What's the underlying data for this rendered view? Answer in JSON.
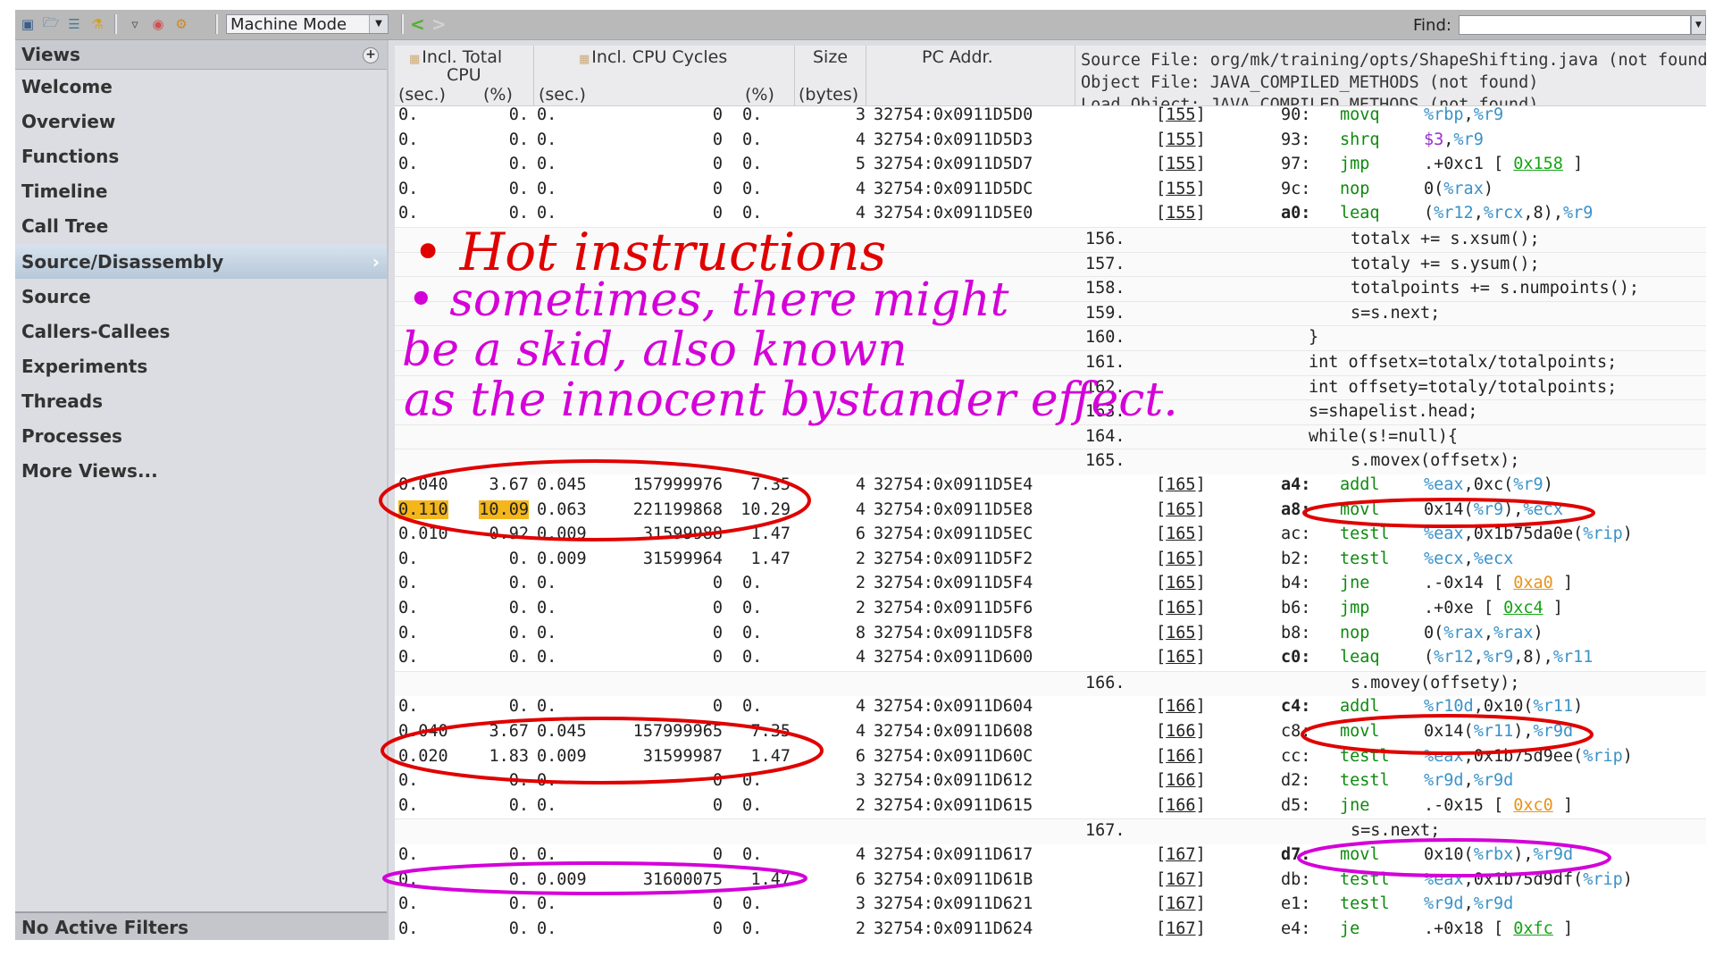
{
  "toolbar": {
    "icons": [
      "save-experiment-icon",
      "open-experiment-icon",
      "compare-icon",
      "new-experiment-icon",
      "filter-icon",
      "profile-icon",
      "settings-icon"
    ],
    "mode_select": "Machine Mode",
    "find_label": "Find:",
    "find_value": ""
  },
  "sidebar": {
    "title": "Views",
    "items": [
      {
        "label": "Welcome"
      },
      {
        "label": "Overview"
      },
      {
        "label": "Functions"
      },
      {
        "label": "Timeline"
      },
      {
        "label": "Call Tree"
      },
      {
        "label": "Source/Disassembly",
        "selected": true
      },
      {
        "label": "Source"
      },
      {
        "label": "Callers-Callees"
      },
      {
        "label": "Experiments"
      },
      {
        "label": "Threads"
      },
      {
        "label": "Processes"
      },
      {
        "label": "More Views..."
      }
    ],
    "filters_label": "No Active Filters"
  },
  "table": {
    "headers": {
      "incl_total_cpu": "Incl. Total CPU",
      "incl_total_cpu_line1": "Incl. Total",
      "incl_total_cpu_line2": "CPU",
      "incl_total_sec": "(sec.)",
      "incl_total_pct": "(%)",
      "incl_cycles": "Incl. CPU Cycles",
      "incl_cycles_sec": "(sec.)",
      "incl_cycles_pct": "(%)",
      "size": "Size",
      "size_unit": "(bytes)",
      "pc_addr": "PC Addr."
    },
    "info": {
      "source_file": "Source File: org/mk/training/opts/ShapeShifting.java (not found)",
      "object_file": "Object File: JAVA_COMPILED_METHODS (not found)",
      "load_object": "Load Object: JAVA_COMPILED_METHODS (not found)"
    },
    "rows": [
      {
        "type": "instr",
        "tsec": "0.",
        "tpct": "0.",
        "csec": "0.",
        "cyc": "0",
        "cpct": "0.",
        "size": "3",
        "pc": "32754:0x0911D5D0",
        "line": "155",
        "off": "90:",
        "mn": "movq",
        "ops": [
          [
            "reg",
            "%rbp"
          ],
          [
            "txt",
            ","
          ],
          [
            "reg",
            "%r9"
          ]
        ]
      },
      {
        "type": "instr",
        "tsec": "0.",
        "tpct": "0.",
        "csec": "0.",
        "cyc": "0",
        "cpct": "0.",
        "size": "4",
        "pc": "32754:0x0911D5D3",
        "line": "155",
        "off": "93:",
        "mn": "shrq",
        "ops": [
          [
            "imm",
            "$3"
          ],
          [
            "txt",
            ","
          ],
          [
            "reg",
            "%r9"
          ]
        ]
      },
      {
        "type": "instr",
        "tsec": "0.",
        "tpct": "0.",
        "csec": "0.",
        "cyc": "0",
        "cpct": "0.",
        "size": "5",
        "pc": "32754:0x0911D5D7",
        "line": "155",
        "off": "97:",
        "mn": "jmp",
        "ops": [
          [
            "txt",
            ".+0xc1 [ "
          ],
          [
            "lg",
            "0x158"
          ],
          [
            "txt",
            " ]"
          ]
        ]
      },
      {
        "type": "instr",
        "tsec": "0.",
        "tpct": "0.",
        "csec": "0.",
        "cyc": "0",
        "cpct": "0.",
        "size": "4",
        "pc": "32754:0x0911D5DC",
        "line": "155",
        "off": "9c:",
        "mn": "nop",
        "ops": [
          [
            "txt",
            "0("
          ],
          [
            "reg",
            "%rax"
          ],
          [
            "txt",
            ")"
          ]
        ]
      },
      {
        "type": "instr",
        "tsec": "0.",
        "tpct": "0.",
        "csec": "0.",
        "cyc": "0",
        "cpct": "0.",
        "size": "4",
        "pc": "32754:0x0911D5E0",
        "line": "155",
        "off": "a0:",
        "bold": true,
        "mn": "leaq",
        "ops": [
          [
            "txt",
            "("
          ],
          [
            "reg",
            "%r12"
          ],
          [
            "txt",
            ","
          ],
          [
            "reg",
            "%rcx"
          ],
          [
            "txt",
            ",8),"
          ],
          [
            "reg",
            "%r9"
          ]
        ]
      },
      {
        "type": "src",
        "no": "156.",
        "indent": 3,
        "text": "totalx += s.xsum();"
      },
      {
        "type": "src",
        "no": "157.",
        "indent": 3,
        "text": "totaly += s.ysum();"
      },
      {
        "type": "src",
        "no": "158.",
        "indent": 3,
        "text": "totalpoints += s.numpoints();"
      },
      {
        "type": "src",
        "no": "159.",
        "indent": 3,
        "text": "s=s.next;"
      },
      {
        "type": "src",
        "no": "160.",
        "indent": 2,
        "text": "}"
      },
      {
        "type": "src",
        "no": "161.",
        "indent": 2,
        "text": "int offsetx=totalx/totalpoints;"
      },
      {
        "type": "src",
        "no": "162.",
        "indent": 2,
        "text": "int offsety=totaly/totalpoints;"
      },
      {
        "type": "src",
        "no": "163.",
        "indent": 2,
        "text": "s=shapelist.head;"
      },
      {
        "type": "src",
        "no": "164.",
        "indent": 2,
        "text": "while(s!=null){"
      },
      {
        "type": "src",
        "no": "165.",
        "indent": 3,
        "text": "s.movex(offsetx);"
      },
      {
        "type": "instr",
        "tsec": "0.040",
        "tpct": "3.67",
        "csec": "0.045",
        "cyc": "157999976",
        "cpct": "7.35",
        "size": "4",
        "pc": "32754:0x0911D5E4",
        "line": "165",
        "off": "a4:",
        "bold": true,
        "mn": "addl",
        "ops": [
          [
            "reg",
            "%eax"
          ],
          [
            "txt",
            ",0xc("
          ],
          [
            "reg",
            "%r9"
          ],
          [
            "txt",
            ")"
          ]
        ]
      },
      {
        "type": "instr",
        "hot": true,
        "tsec": "0.110",
        "tpct": "10.09",
        "csec": "0.063",
        "cyc": "221199868",
        "cpct": "10.29",
        "size": "4",
        "pc": "32754:0x0911D5E8",
        "line": "165",
        "off": "a8:",
        "bold": true,
        "mn": "movl",
        "ops": [
          [
            "txt",
            "0x14("
          ],
          [
            "reg",
            "%r9"
          ],
          [
            "txt",
            "),"
          ],
          [
            "reg",
            "%ecx"
          ]
        ]
      },
      {
        "type": "instr",
        "tsec": "0.010",
        "tpct": "0.92",
        "csec": "0.009",
        "cyc": "31599988",
        "cpct": "1.47",
        "size": "6",
        "pc": "32754:0x0911D5EC",
        "line": "165",
        "off": "ac:",
        "mn": "testl",
        "ops": [
          [
            "reg",
            "%eax"
          ],
          [
            "txt",
            ",0x1b75da0e("
          ],
          [
            "reg",
            "%rip"
          ],
          [
            "txt",
            ")"
          ]
        ]
      },
      {
        "type": "instr",
        "tsec": "0.",
        "tpct": "0.",
        "csec": "0.009",
        "cyc": "31599964",
        "cpct": "1.47",
        "size": "2",
        "pc": "32754:0x0911D5F2",
        "line": "165",
        "off": "b2:",
        "mn": "testl",
        "ops": [
          [
            "reg",
            "%ecx"
          ],
          [
            "txt",
            ","
          ],
          [
            "reg",
            "%ecx"
          ]
        ]
      },
      {
        "type": "instr",
        "tsec": "0.",
        "tpct": "0.",
        "csec": "0.",
        "cyc": "0",
        "cpct": "0.",
        "size": "2",
        "pc": "32754:0x0911D5F4",
        "line": "165",
        "off": "b4:",
        "mn": "jne",
        "ops": [
          [
            "txt",
            ".-0x14 [ "
          ],
          [
            "lo",
            "0xa0"
          ],
          [
            "txt",
            " ]"
          ]
        ]
      },
      {
        "type": "instr",
        "tsec": "0.",
        "tpct": "0.",
        "csec": "0.",
        "cyc": "0",
        "cpct": "0.",
        "size": "2",
        "pc": "32754:0x0911D5F6",
        "line": "165",
        "off": "b6:",
        "mn": "jmp",
        "ops": [
          [
            "txt",
            ".+0xe [ "
          ],
          [
            "lg",
            "0xc4"
          ],
          [
            "txt",
            " ]"
          ]
        ]
      },
      {
        "type": "instr",
        "tsec": "0.",
        "tpct": "0.",
        "csec": "0.",
        "cyc": "0",
        "cpct": "0.",
        "size": "8",
        "pc": "32754:0x0911D5F8",
        "line": "165",
        "off": "b8:",
        "mn": "nop",
        "ops": [
          [
            "txt",
            "0("
          ],
          [
            "reg",
            "%rax"
          ],
          [
            "txt",
            ","
          ],
          [
            "reg",
            "%rax"
          ],
          [
            "txt",
            ")"
          ]
        ]
      },
      {
        "type": "instr",
        "tsec": "0.",
        "tpct": "0.",
        "csec": "0.",
        "cyc": "0",
        "cpct": "0.",
        "size": "4",
        "pc": "32754:0x0911D600",
        "line": "165",
        "off": "c0:",
        "bold": true,
        "mn": "leaq",
        "ops": [
          [
            "txt",
            "("
          ],
          [
            "reg",
            "%r12"
          ],
          [
            "txt",
            ","
          ],
          [
            "reg",
            "%r9"
          ],
          [
            "txt",
            ",8),"
          ],
          [
            "reg",
            "%r11"
          ]
        ]
      },
      {
        "type": "src",
        "no": "166.",
        "indent": 3,
        "text": "s.movey(offsety);"
      },
      {
        "type": "instr",
        "tsec": "0.",
        "tpct": "0.",
        "csec": "0.",
        "cyc": "0",
        "cpct": "0.",
        "size": "4",
        "pc": "32754:0x0911D604",
        "line": "166",
        "off": "c4:",
        "bold": true,
        "mn": "addl",
        "ops": [
          [
            "reg",
            "%r10d"
          ],
          [
            "txt",
            ",0x10("
          ],
          [
            "reg",
            "%r11"
          ],
          [
            "txt",
            ")"
          ]
        ]
      },
      {
        "type": "instr",
        "tsec": "0.040",
        "tpct": "3.67",
        "csec": "0.045",
        "cyc": "157999965",
        "cpct": "7.35",
        "size": "4",
        "pc": "32754:0x0911D608",
        "line": "166",
        "off": "c8:",
        "mn": "movl",
        "ops": [
          [
            "txt",
            "0x14("
          ],
          [
            "reg",
            "%r11"
          ],
          [
            "txt",
            "),"
          ],
          [
            "reg",
            "%r9d"
          ]
        ]
      },
      {
        "type": "instr",
        "tsec": "0.020",
        "tpct": "1.83",
        "csec": "0.009",
        "cyc": "31599987",
        "cpct": "1.47",
        "size": "6",
        "pc": "32754:0x0911D60C",
        "line": "166",
        "off": "cc:",
        "mn": "testl",
        "ops": [
          [
            "reg",
            "%eax"
          ],
          [
            "txt",
            ",0x1b75d9ee("
          ],
          [
            "reg",
            "%rip"
          ],
          [
            "txt",
            ")"
          ]
        ]
      },
      {
        "type": "instr",
        "tsec": "0.",
        "tpct": "0.",
        "csec": "0.",
        "cyc": "0",
        "cpct": "0.",
        "size": "3",
        "pc": "32754:0x0911D612",
        "line": "166",
        "off": "d2:",
        "mn": "testl",
        "ops": [
          [
            "reg",
            "%r9d"
          ],
          [
            "txt",
            ","
          ],
          [
            "reg",
            "%r9d"
          ]
        ]
      },
      {
        "type": "instr",
        "tsec": "0.",
        "tpct": "0.",
        "csec": "0.",
        "cyc": "0",
        "cpct": "0.",
        "size": "2",
        "pc": "32754:0x0911D615",
        "line": "166",
        "off": "d5:",
        "mn": "jne",
        "ops": [
          [
            "txt",
            ".-0x15 [ "
          ],
          [
            "lo",
            "0xc0"
          ],
          [
            "txt",
            " ]"
          ]
        ]
      },
      {
        "type": "src",
        "no": "167.",
        "indent": 3,
        "text": "s=s.next;"
      },
      {
        "type": "instr",
        "tsec": "0.",
        "tpct": "0.",
        "csec": "0.",
        "cyc": "0",
        "cpct": "0.",
        "size": "4",
        "pc": "32754:0x0911D617",
        "line": "167",
        "off": "d7:",
        "bold": true,
        "mn": "movl",
        "ops": [
          [
            "txt",
            "0x10("
          ],
          [
            "reg",
            "%rbx"
          ],
          [
            "txt",
            "),"
          ],
          [
            "reg",
            "%r9d"
          ]
        ]
      },
      {
        "type": "instr",
        "tsec": "0.",
        "tpct": "0.",
        "csec": "0.009",
        "cyc": "31600075",
        "cpct": "1.47",
        "size": "6",
        "pc": "32754:0x0911D61B",
        "line": "167",
        "off": "db:",
        "mn": "testl",
        "ops": [
          [
            "reg",
            "%eax"
          ],
          [
            "txt",
            ",0x1b75d9df("
          ],
          [
            "reg",
            "%rip"
          ],
          [
            "txt",
            ")"
          ]
        ]
      },
      {
        "type": "instr",
        "tsec": "0.",
        "tpct": "0.",
        "csec": "0.",
        "cyc": "0",
        "cpct": "0.",
        "size": "3",
        "pc": "32754:0x0911D621",
        "line": "167",
        "off": "e1:",
        "mn": "testl",
        "ops": [
          [
            "reg",
            "%r9d"
          ],
          [
            "txt",
            ","
          ],
          [
            "reg",
            "%r9d"
          ]
        ]
      },
      {
        "type": "instr",
        "tsec": "0.",
        "tpct": "0.",
        "csec": "0.",
        "cyc": "0",
        "cpct": "0.",
        "size": "2",
        "pc": "32754:0x0911D624",
        "line": "167",
        "off": "e4:",
        "mn": "je",
        "ops": [
          [
            "txt",
            ".+0x18 [ "
          ],
          [
            "lg",
            "0xfc"
          ],
          [
            "txt",
            " ]"
          ]
        ]
      }
    ]
  },
  "annotations": {
    "line1": "• Hot instructions",
    "line2": "• sometimes, there might",
    "line3": "be a skid, also known",
    "line4": "as the innocent bystander effect.",
    "colors": {
      "red": "#e00000",
      "magenta": "#d400d8"
    }
  }
}
